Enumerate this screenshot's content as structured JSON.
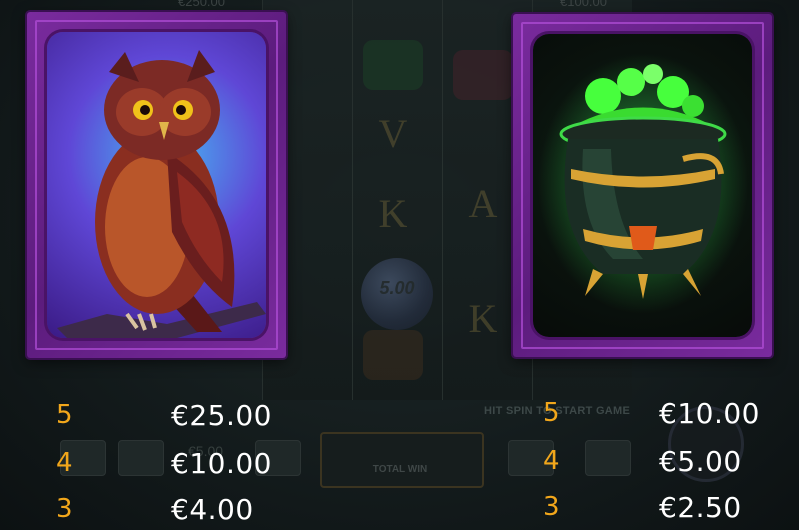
{
  "background": {
    "top_amounts": [
      "€250.00",
      "€100.00"
    ],
    "coin_value": "5.00",
    "hint_text": "HIT SPIN TO START GAME",
    "total_win_label": "TOTAL WIN",
    "bet_amount": "€5.00"
  },
  "symbols": [
    {
      "name": "owl",
      "payouts": [
        {
          "count": "5",
          "value": "€25.00"
        },
        {
          "count": "4",
          "value": "€10.00"
        },
        {
          "count": "3",
          "value": "€4.00"
        }
      ]
    },
    {
      "name": "cauldron",
      "payouts": [
        {
          "count": "5",
          "value": "€10.00"
        },
        {
          "count": "4",
          "value": "€5.00"
        },
        {
          "count": "3",
          "value": "€2.50"
        }
      ]
    }
  ],
  "colors": {
    "count": "#f2a71b",
    "value": "#ffffff",
    "card_purple": "#7a2b9e"
  }
}
